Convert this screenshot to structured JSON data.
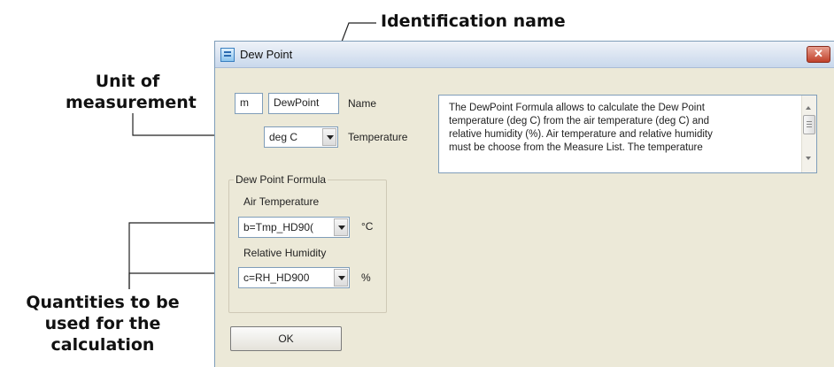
{
  "annotations": {
    "identification_name": "Identification name",
    "unit_of_measurement_line1": "Unit of",
    "unit_of_measurement_line2": "measurement",
    "quantities_line1": "Quantities to be",
    "quantities_line2": "used for the",
    "quantities_line3": "calculation"
  },
  "window": {
    "title": "Dew Point",
    "close_glyph": "✕",
    "icon": "app-window-icon"
  },
  "form": {
    "id_field_value": "m",
    "name_field_value": "DewPoint",
    "name_label": "Name",
    "unit_select_value": "deg C",
    "temperature_label": "Temperature",
    "group_title": "Dew Point Formula",
    "air_temp_label": "Air Temperature",
    "air_temp_select_value": "b=Tmp_HD90(",
    "air_temp_unit": "°C",
    "rh_label": "Relative Humidity",
    "rh_select_value": "c=RH_HD900",
    "rh_unit": "%",
    "ok_label": "OK"
  },
  "description": {
    "line1": "The DewPoint Formula allows to calculate the Dew Point",
    "line2": "temperature (deg C) from the air temperature (deg C) and",
    "line3": "relative humidity (%). Air temperature and relative humidity",
    "line4": "must be choose from the Measure List. The temperature"
  },
  "colors": {
    "dialog_bg": "#ece9d8",
    "titlebar": "#c9d8ec",
    "close_button": "#c0402a",
    "field_border": "#7f9db9"
  }
}
